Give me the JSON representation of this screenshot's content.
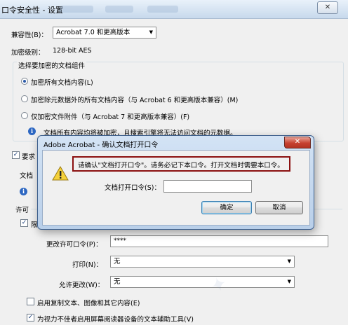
{
  "window": {
    "title": "口令安全性 - 设置",
    "close_glyph": "✕"
  },
  "compat": {
    "label": "兼容性(B)：",
    "value": "Acrobat 7.0 和更高版本"
  },
  "encryption_level": {
    "label": "加密级别：",
    "value": "128-bit AES"
  },
  "components": {
    "heading": "选择要加密的文档组件",
    "options": [
      {
        "label": "加密所有文档内容(L)",
        "selected": true
      },
      {
        "label": "加密除元数据外的所有文档内容（与 Acrobat 6 和更高版本兼容）(M)",
        "selected": false
      },
      {
        "label": "仅加密文件附件（与 Acrobat 7 和更高版本兼容）(F)",
        "selected": false
      }
    ],
    "info_text": "文档所有内容均将被加密，且搜索引擎将无法访问文档的元数据。"
  },
  "require_open": {
    "label": "要求",
    "checked": true
  },
  "doc_open_label": "文档",
  "permissions": {
    "label": "许可",
    "restrict_label": "限",
    "change_password_label": "更改许可口令(P)：",
    "change_password_value": "****",
    "print_label": "打印(N)：",
    "print_value": "无",
    "changes_label": "允许更改(W)：",
    "changes_value": "无",
    "enable_copy": {
      "label": "启用复制文本、图像和其它内容(E)",
      "checked": false
    },
    "accessibility": {
      "label": "为视力不佳者启用屏幕阅读器设备的文本辅助工具(V)",
      "checked": true
    }
  },
  "dialog": {
    "title": "Adobe Acrobat - 确认文档打开口令",
    "close_glyph": "✕",
    "message": "请确认\"文档打开口令\"。请务必记下本口令。打开文档时需要本口令。",
    "field_label": "文档打开口令(S)：",
    "field_value": "",
    "ok_label": "确定",
    "cancel_label": "取消"
  },
  "icons": {
    "info": "i",
    "warning": "!",
    "dropdown": "▼",
    "check": "✓"
  },
  "colors": {
    "dialog_highlight": "#8b1010",
    "close_button": "#c74130",
    "title_gradient": "#c7d9ec"
  }
}
